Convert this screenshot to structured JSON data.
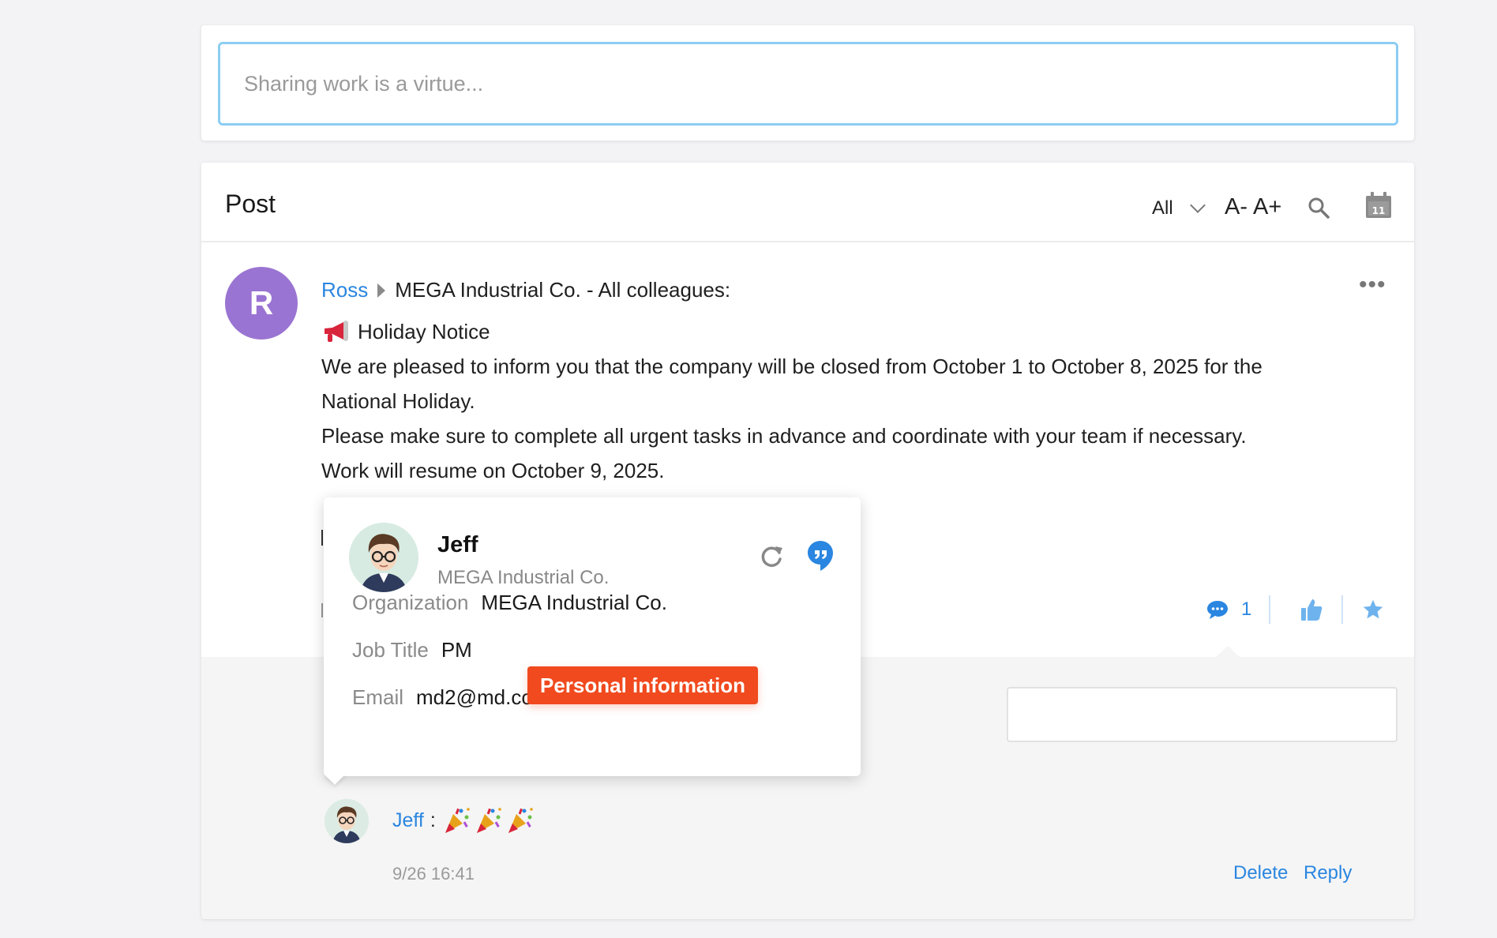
{
  "share": {
    "placeholder": "Sharing work is a virtue..."
  },
  "post_header": {
    "title": "Post",
    "filter": "All",
    "font_decrease": "A-",
    "font_increase": "A+",
    "calendar_day": "11"
  },
  "post": {
    "avatar_letter": "R",
    "author": "Ross",
    "target": "MEGA Industrial Co. - All colleagues:",
    "more": "•••",
    "notice_title": "Holiday Notice",
    "paragraph1": "We are pleased to inform you that the company will be closed from October 1 to October 8, 2025 for the National Holiday.",
    "paragraph2": "Please make sure to complete all urgent tasks in advance and coordinate with your team if necessary.",
    "paragraph3": "Work will resume on October 9, 2025.",
    "comment_count": "1"
  },
  "comment": {
    "author": "Jeff",
    "colon": ":",
    "time": "9/26 16:41",
    "delete_label": "Delete",
    "reply_label": "Reply"
  },
  "popover": {
    "name": "Jeff",
    "company": "MEGA Industrial Co.",
    "org_label": "Organization",
    "org_value": "MEGA Industrial Co.",
    "job_label": "Job Title",
    "job_value": "PM",
    "email_label": "Email",
    "email_value": "md2@md.com",
    "badge": "Personal information"
  },
  "colors": {
    "accent_blue": "#2a86e0",
    "avatar_purple": "#9a74d2",
    "badge_red": "#f04a1e",
    "input_border": "#8ccdf3"
  },
  "icons": [
    "chevron-down-icon",
    "search-icon",
    "calendar-icon",
    "more-icon",
    "megaphone-icon",
    "comment-icon",
    "thumbs-up-icon",
    "star-icon",
    "refresh-icon",
    "quote-icon",
    "party-popper-icon"
  ]
}
